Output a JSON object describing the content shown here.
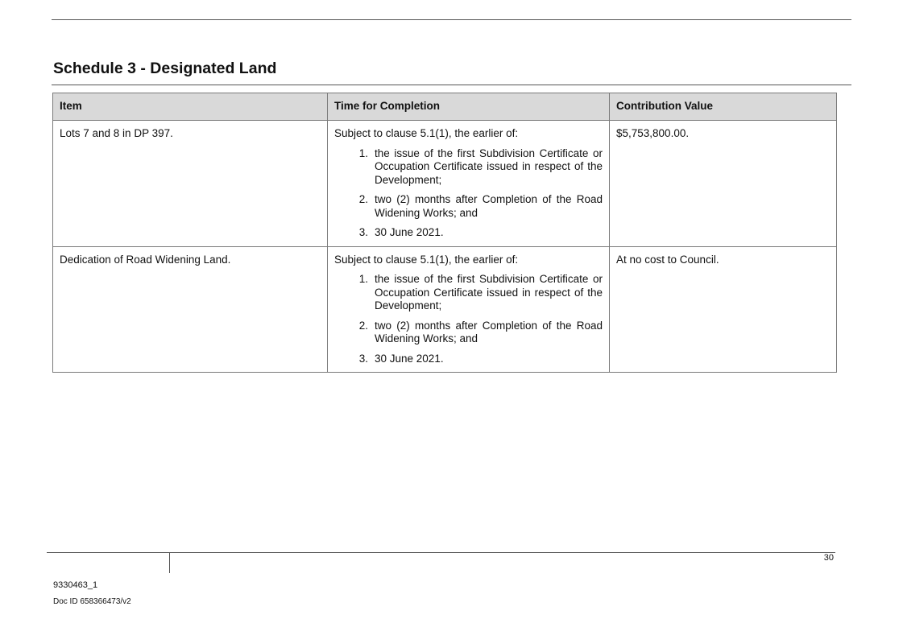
{
  "title": "Schedule 3 - Designated Land",
  "table": {
    "headers": [
      "Item",
      "Time for Completion",
      "Contribution Value"
    ],
    "rows": [
      {
        "item": "Lots 7 and 8 in DP 397.",
        "lead": "Subject to clause 5.1(1), the earlier of:",
        "conditions": [
          {
            "num": "1.",
            "text": "the issue of the first Subdivision Certificate or Occupation Certificate issued in respect of the Development;"
          },
          {
            "num": "2.",
            "text": "two (2) months after Completion of the Road Widening Works; and"
          },
          {
            "num": "3.",
            "text": "30 June 2021."
          }
        ],
        "value": "$5,753,800.00."
      },
      {
        "item": "Dedication of Road Widening Land.",
        "lead": "Subject to clause 5.1(1), the earlier of:",
        "conditions": [
          {
            "num": "1.",
            "text": "the issue of the first Subdivision Certificate or Occupation Certificate issued in respect of the Development;"
          },
          {
            "num": "2.",
            "text": "two (2) months after Completion of the Road Widening Works; and"
          },
          {
            "num": "3.",
            "text": "30 June 2021."
          }
        ],
        "value": "At no cost to Council."
      }
    ]
  },
  "footer": {
    "page_number": "30",
    "doc_ref": "9330463_1",
    "doc_id": "Doc ID 658366473/v2"
  }
}
